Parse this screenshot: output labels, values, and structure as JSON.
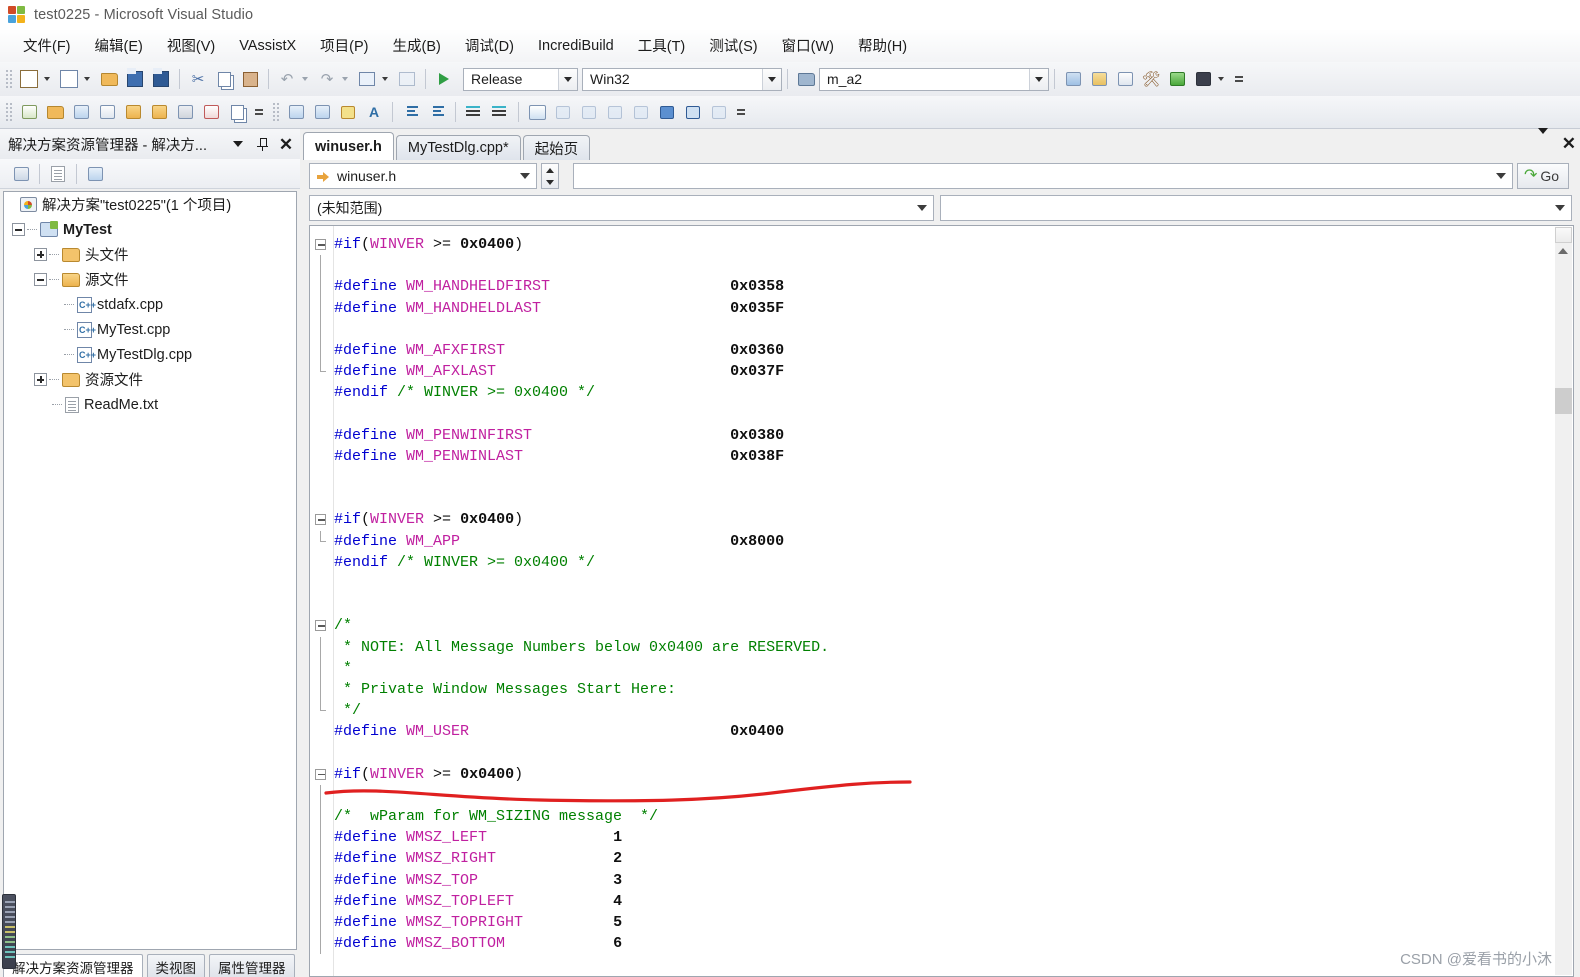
{
  "window": {
    "title": "test0225 - Microsoft Visual Studio",
    "logo_icon": "visual-studio-logo-icon"
  },
  "menubar": {
    "items": [
      {
        "label": "文件(F)"
      },
      {
        "label": "编辑(E)"
      },
      {
        "label": "视图(V)"
      },
      {
        "label": "VAssistX"
      },
      {
        "label": "项目(P)"
      },
      {
        "label": "生成(B)"
      },
      {
        "label": "调试(D)"
      },
      {
        "label": "IncrediBuild"
      },
      {
        "label": "工具(T)"
      },
      {
        "label": "测试(S)"
      },
      {
        "label": "窗口(W)"
      },
      {
        "label": "帮助(H)"
      }
    ]
  },
  "toolbar": {
    "configuration": "Release",
    "platform": "Win32",
    "find_value": "m_a2",
    "buttons": [
      {
        "name": "new-project-icon"
      },
      {
        "name": "add-new-item-icon"
      },
      {
        "name": "open-file-icon"
      },
      {
        "name": "save-icon"
      },
      {
        "name": "save-all-icon"
      },
      {
        "name": "cut-icon"
      },
      {
        "name": "copy-icon"
      },
      {
        "name": "paste-icon"
      },
      {
        "name": "undo-icon"
      },
      {
        "name": "redo-icon"
      },
      {
        "name": "navigate-backward-icon"
      },
      {
        "name": "navigate-forward-icon"
      },
      {
        "name": "start-debugging-icon"
      }
    ],
    "right_buttons": [
      {
        "name": "find-in-files-icon"
      },
      {
        "name": "properties-window-icon"
      },
      {
        "name": "object-browser-icon"
      },
      {
        "name": "toolbox-icon"
      },
      {
        "name": "immediate-window-icon"
      },
      {
        "name": "command-window-icon"
      }
    ]
  },
  "toolbar2": {
    "left_buttons": [
      {
        "name": "vassist-find-symbol-icon"
      },
      {
        "name": "vassist-open-file-icon"
      },
      {
        "name": "vassist-refactor-icon"
      },
      {
        "name": "vassist-find-references-icon"
      },
      {
        "name": "vassist-undo-icon"
      },
      {
        "name": "vassist-redo-icon"
      },
      {
        "name": "vassist-code-icon"
      },
      {
        "name": "vassist-spellcheck-icon"
      },
      {
        "name": "vassist-paste-icon"
      }
    ],
    "right_buttons": [
      {
        "name": "insert-snippet-icon"
      },
      {
        "name": "surround-with-icon"
      },
      {
        "name": "toggle-bookmark-icon"
      },
      {
        "name": "display-tooltip-icon"
      },
      {
        "name": "comment-selection-icon"
      },
      {
        "name": "uncomment-selection-icon"
      },
      {
        "name": "increase-indent-icon"
      },
      {
        "name": "decrease-indent-icon"
      },
      {
        "name": "toggle-all-outlining-icon"
      },
      {
        "name": "collapse-to-definitions-icon"
      },
      {
        "name": "new-breakpoint-icon"
      },
      {
        "name": "step-into-icon"
      },
      {
        "name": "step-over-icon"
      },
      {
        "name": "step-out-icon"
      },
      {
        "name": "run-to-cursor-icon"
      },
      {
        "name": "set-next-statement-icon"
      },
      {
        "name": "show-next-statement-icon"
      },
      {
        "name": "delete-breakpoint-icon"
      }
    ]
  },
  "solution_explorer": {
    "title": "解决方案资源管理器 - 解决方...",
    "dropdown_icon": "chevron-down-icon",
    "pin_icon": "pin-icon",
    "close_icon": "close-icon",
    "toolbar_buttons": [
      {
        "name": "properties-icon"
      },
      {
        "name": "show-all-files-icon"
      },
      {
        "name": "view-class-diagram-icon"
      }
    ],
    "tree": [
      {
        "label": "解决方案\"test0225\"(1 个项目)",
        "icon": "solution-icon",
        "depth": 0,
        "expander": "none",
        "bold": false
      },
      {
        "label": "MyTest",
        "icon": "project-icon",
        "depth": 1,
        "expander": "minus",
        "bold": true
      },
      {
        "label": "头文件",
        "icon": "folder-icon",
        "depth": 2,
        "expander": "plus",
        "bold": false
      },
      {
        "label": "源文件",
        "icon": "folder-open-icon",
        "depth": 2,
        "expander": "minus",
        "bold": false
      },
      {
        "label": "stdafx.cpp",
        "icon": "cpp-file-icon",
        "depth": 3,
        "expander": "none",
        "bold": false
      },
      {
        "label": "MyTest.cpp",
        "icon": "cpp-file-icon",
        "depth": 3,
        "expander": "none",
        "bold": false
      },
      {
        "label": "MyTestDlg.cpp",
        "icon": "cpp-file-icon",
        "depth": 3,
        "expander": "none",
        "bold": false
      },
      {
        "label": "资源文件",
        "icon": "folder-icon",
        "depth": 2,
        "expander": "plus",
        "bold": false
      },
      {
        "label": "ReadMe.txt",
        "icon": "text-file-icon",
        "depth": 2,
        "expander": "none",
        "bold": false
      }
    ],
    "bottom_tabs": [
      {
        "label": "解决方案资源管理器",
        "active": true
      },
      {
        "label": "类视图",
        "active": false
      },
      {
        "label": "属性管理器",
        "active": false
      }
    ]
  },
  "editor": {
    "tabs": [
      {
        "label": "winuser.h",
        "active": true
      },
      {
        "label": "MyTestDlg.cpp*",
        "active": false
      },
      {
        "label": "起始页",
        "active": false
      }
    ],
    "tab_dropdown_icon": "chevron-down-icon",
    "tab_close_icon": "close-icon",
    "nav": {
      "file_combo": "winuser.h",
      "file_icon": "arrow-right-icon",
      "search_value": "",
      "go_label": "Go",
      "go_icon": "go-arrow-icon",
      "spinner_icon": "spinner-updown-icon"
    },
    "scope": {
      "left": "(未知范围)",
      "right": ""
    },
    "scrollbar": {
      "up_icon": "scroll-up-arrow-icon",
      "thumb": "scroll-thumb"
    },
    "annotation": {
      "name": "red-underline-annotation",
      "color": "#e02020"
    },
    "code": [
      {
        "fold": "start",
        "tokens": [
          [
            "kw",
            "#if"
          ],
          [
            "pl",
            "("
          ],
          [
            "mac",
            "WINVER"
          ],
          [
            "pl",
            " >= "
          ],
          [
            "num",
            "0x0400"
          ],
          [
            "pl",
            ")"
          ]
        ]
      },
      {
        "fold": "mid",
        "tokens": []
      },
      {
        "fold": "mid",
        "tokens": [
          [
            "kw",
            "#define"
          ],
          [
            "pl",
            " "
          ],
          [
            "mac",
            "WM_HANDHELDFIRST"
          ],
          [
            "pl",
            "                    "
          ],
          [
            "num",
            "0x0358"
          ]
        ]
      },
      {
        "fold": "mid",
        "tokens": [
          [
            "kw",
            "#define"
          ],
          [
            "pl",
            " "
          ],
          [
            "mac",
            "WM_HANDHELDLAST"
          ],
          [
            "pl",
            "                     "
          ],
          [
            "num",
            "0x035F"
          ]
        ]
      },
      {
        "fold": "mid",
        "tokens": []
      },
      {
        "fold": "mid",
        "tokens": [
          [
            "kw",
            "#define"
          ],
          [
            "pl",
            " "
          ],
          [
            "mac",
            "WM_AFXFIRST"
          ],
          [
            "pl",
            "                         "
          ],
          [
            "num",
            "0x0360"
          ]
        ]
      },
      {
        "fold": "end",
        "tokens": [
          [
            "kw",
            "#define"
          ],
          [
            "pl",
            " "
          ],
          [
            "mac",
            "WM_AFXLAST"
          ],
          [
            "pl",
            "                          "
          ],
          [
            "num",
            "0x037F"
          ]
        ]
      },
      {
        "fold": "none",
        "tokens": [
          [
            "kw",
            "#endif"
          ],
          [
            "pl",
            " "
          ],
          [
            "cmt",
            "/* WINVER >= 0x0400 */"
          ]
        ]
      },
      {
        "fold": "none",
        "tokens": []
      },
      {
        "fold": "none",
        "tokens": [
          [
            "kw",
            "#define"
          ],
          [
            "pl",
            " "
          ],
          [
            "mac",
            "WM_PENWINFIRST"
          ],
          [
            "pl",
            "                      "
          ],
          [
            "num",
            "0x0380"
          ]
        ]
      },
      {
        "fold": "none",
        "tokens": [
          [
            "kw",
            "#define"
          ],
          [
            "pl",
            " "
          ],
          [
            "mac",
            "WM_PENWINLAST"
          ],
          [
            "pl",
            "                       "
          ],
          [
            "num",
            "0x038F"
          ]
        ]
      },
      {
        "fold": "none",
        "tokens": []
      },
      {
        "fold": "none",
        "tokens": []
      },
      {
        "fold": "start",
        "tokens": [
          [
            "kw",
            "#if"
          ],
          [
            "pl",
            "("
          ],
          [
            "mac",
            "WINVER"
          ],
          [
            "pl",
            " >= "
          ],
          [
            "num",
            "0x0400"
          ],
          [
            "pl",
            ")"
          ]
        ]
      },
      {
        "fold": "end",
        "tokens": [
          [
            "kw",
            "#define"
          ],
          [
            "pl",
            " "
          ],
          [
            "mac",
            "WM_APP"
          ],
          [
            "pl",
            "                              "
          ],
          [
            "num",
            "0x8000"
          ]
        ]
      },
      {
        "fold": "none",
        "tokens": [
          [
            "kw",
            "#endif"
          ],
          [
            "pl",
            " "
          ],
          [
            "cmt",
            "/* WINVER >= 0x0400 */"
          ]
        ]
      },
      {
        "fold": "none",
        "tokens": []
      },
      {
        "fold": "none",
        "tokens": []
      },
      {
        "fold": "start",
        "tokens": [
          [
            "cmt",
            "/*"
          ]
        ]
      },
      {
        "fold": "mid",
        "tokens": [
          [
            "cmt",
            " * NOTE: All Message Numbers below 0x0400 are RESERVED."
          ]
        ]
      },
      {
        "fold": "mid",
        "tokens": [
          [
            "cmt",
            " *"
          ]
        ]
      },
      {
        "fold": "mid",
        "tokens": [
          [
            "cmt",
            " * Private Window Messages Start Here:"
          ]
        ]
      },
      {
        "fold": "end",
        "tokens": [
          [
            "cmt",
            " */"
          ]
        ]
      },
      {
        "fold": "none",
        "tokens": [
          [
            "kw",
            "#define"
          ],
          [
            "pl",
            " "
          ],
          [
            "mac",
            "WM_USER"
          ],
          [
            "pl",
            "                             "
          ],
          [
            "num",
            "0x0400"
          ]
        ]
      },
      {
        "fold": "none",
        "tokens": []
      },
      {
        "fold": "start",
        "tokens": [
          [
            "kw",
            "#if"
          ],
          [
            "pl",
            "("
          ],
          [
            "mac",
            "WINVER"
          ],
          [
            "pl",
            " >= "
          ],
          [
            "num",
            "0x0400"
          ],
          [
            "pl",
            ")"
          ]
        ]
      },
      {
        "fold": "mid",
        "tokens": []
      },
      {
        "fold": "mid",
        "tokens": [
          [
            "cmt",
            "/*  wParam for WM_SIZING message  */"
          ]
        ]
      },
      {
        "fold": "mid",
        "tokens": [
          [
            "kw",
            "#define"
          ],
          [
            "pl",
            " "
          ],
          [
            "mac",
            "WMSZ_LEFT"
          ],
          [
            "pl",
            "              "
          ],
          [
            "num",
            "1"
          ]
        ]
      },
      {
        "fold": "mid",
        "tokens": [
          [
            "kw",
            "#define"
          ],
          [
            "pl",
            " "
          ],
          [
            "mac",
            "WMSZ_RIGHT"
          ],
          [
            "pl",
            "             "
          ],
          [
            "num",
            "2"
          ]
        ]
      },
      {
        "fold": "mid",
        "tokens": [
          [
            "kw",
            "#define"
          ],
          [
            "pl",
            " "
          ],
          [
            "mac",
            "WMSZ_TOP"
          ],
          [
            "pl",
            "               "
          ],
          [
            "num",
            "3"
          ]
        ]
      },
      {
        "fold": "mid",
        "tokens": [
          [
            "kw",
            "#define"
          ],
          [
            "pl",
            " "
          ],
          [
            "mac",
            "WMSZ_TOPLEFT"
          ],
          [
            "pl",
            "           "
          ],
          [
            "num",
            "4"
          ]
        ]
      },
      {
        "fold": "mid",
        "tokens": [
          [
            "kw",
            "#define"
          ],
          [
            "pl",
            " "
          ],
          [
            "mac",
            "WMSZ_TOPRIGHT"
          ],
          [
            "pl",
            "          "
          ],
          [
            "num",
            "5"
          ]
        ]
      },
      {
        "fold": "mid",
        "tokens": [
          [
            "kw",
            "#define"
          ],
          [
            "pl",
            " "
          ],
          [
            "mac",
            "WMSZ_BOTTOM"
          ],
          [
            "pl",
            "            "
          ],
          [
            "num",
            "6"
          ]
        ]
      }
    ]
  },
  "watermark": {
    "text": "CSDN @爱看书的小沐"
  }
}
